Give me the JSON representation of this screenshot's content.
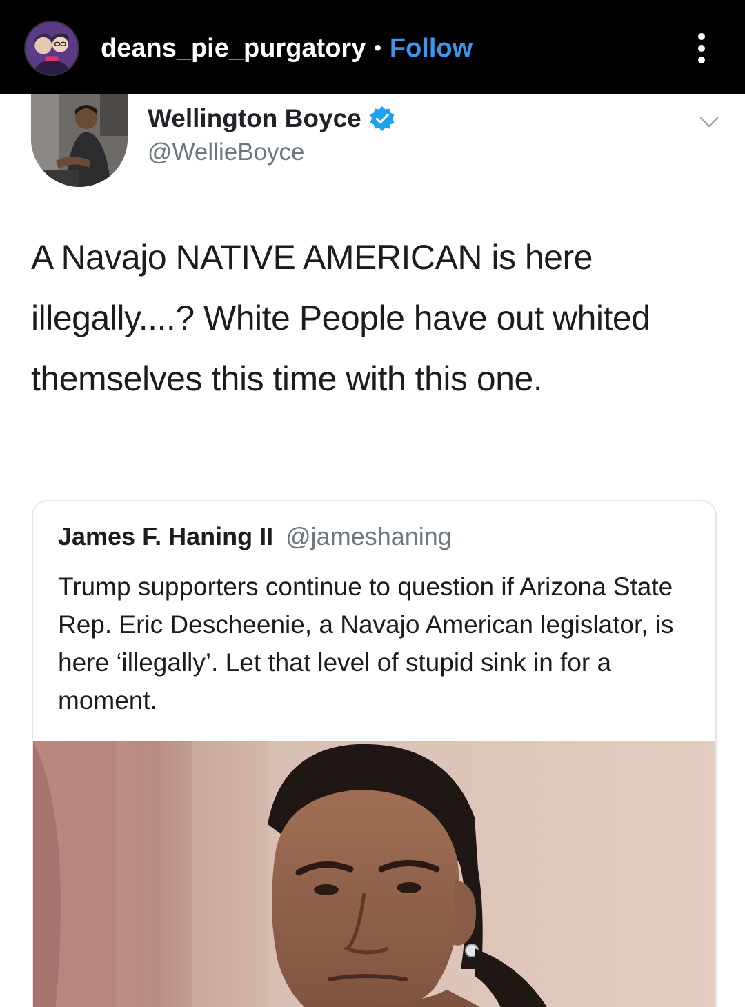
{
  "ig_header": {
    "username": "deans_pie_purgatory",
    "separator": "•",
    "follow_label": "Follow"
  },
  "tweet": {
    "author_name": "Wellington Boyce",
    "author_handle": "@WellieBoyce",
    "verified": true,
    "text": "A Navajo NATIVE AMERICAN is here illegally....? White People have out whited themselves this time with this one."
  },
  "quoted_tweet": {
    "author_name": "James F. Haning II",
    "author_handle": "@jameshaning",
    "text": "Trump supporters continue to question if Arizona State Rep. Eric Descheenie, a Navajo American legislator, is here ‘illegally’. Let that level of stupid sink in for a moment."
  },
  "colors": {
    "header_bg": "#000000",
    "follow_blue": "#3897f0",
    "verified_blue": "#1da1f2",
    "handle_gray": "#6d7781"
  },
  "icons": {
    "more": "more-vertical-icon",
    "chevron": "chevron-down-icon",
    "verified": "verified-badge-icon"
  }
}
